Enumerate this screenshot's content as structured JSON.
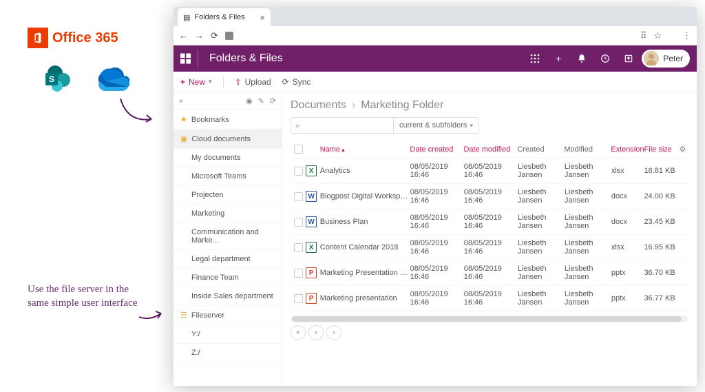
{
  "annotations": {
    "o365": "Office 365",
    "fileserver_note": "Use the file server in the same simple user interface"
  },
  "browser": {
    "tab_title": "Folders & Files"
  },
  "header": {
    "title": "Folders & Files",
    "user_name": "Peter"
  },
  "toolbar": {
    "new_label": "New",
    "upload_label": "Upload",
    "sync_label": "Sync"
  },
  "sidebar": {
    "bookmarks": "Bookmarks",
    "cloud": "Cloud documents",
    "folders": [
      "My documents",
      "Microsoft Teams",
      "Projecten",
      "Marketing",
      "Communication and Marke...",
      "Legal department",
      "Finance Team",
      "Inside Sales department"
    ],
    "fileserver": "Fileserver",
    "drives": [
      "Y:/",
      "Z:/"
    ]
  },
  "breadcrumb": {
    "seg1": "Documents",
    "seg2": "Marketing Folder"
  },
  "search": {
    "scope": "current & subfolders"
  },
  "columns": {
    "name": "Name",
    "date_created": "Date created",
    "date_modified": "Date modified",
    "created": "Created",
    "modified": "Modified",
    "extension": "Extension",
    "file_size": "File size"
  },
  "rows": [
    {
      "name": "Analytics",
      "dc": "08/05/2019 16:46",
      "dm": "08/05/2019 16:46",
      "cby": "Liesbeth Jansen",
      "mby": "Liesbeth Jansen",
      "ext": "xlsx",
      "size": "16.81 KB",
      "icon": "xlsx",
      "glyph": "X"
    },
    {
      "name": "Blogpost Digital Workspace",
      "dc": "08/05/2019 16:46",
      "dm": "08/05/2019 16:46",
      "cby": "Liesbeth Jansen",
      "mby": "Liesbeth Jansen",
      "ext": "docx",
      "size": "24.00 KB",
      "icon": "docx",
      "glyph": "W"
    },
    {
      "name": "Business Plan",
      "dc": "08/05/2019 16:46",
      "dm": "08/05/2019 16:46",
      "cby": "Liesbeth Jansen",
      "mby": "Liesbeth Jansen",
      "ext": "docx",
      "size": "23.45 KB",
      "icon": "docx",
      "glyph": "W"
    },
    {
      "name": "Content Calendar 2018",
      "dc": "08/05/2019 16:46",
      "dm": "08/05/2019 16:46",
      "cby": "Liesbeth Jansen",
      "mby": "Liesbeth Jansen",
      "ext": "xlsx",
      "size": "16.95 KB",
      "icon": "xlsx",
      "glyph": "X"
    },
    {
      "name": "Marketing Presentation Oct...",
      "dc": "08/05/2019 16:46",
      "dm": "08/05/2019 16:46",
      "cby": "Liesbeth Jansen",
      "mby": "Liesbeth Jansen",
      "ext": "pptx",
      "size": "36.70 KB",
      "icon": "pptx",
      "glyph": "P"
    },
    {
      "name": "Marketing presentation",
      "dc": "08/05/2019 16:46",
      "dm": "08/05/2019 16:46",
      "cby": "Liesbeth Jansen",
      "mby": "Liesbeth Jansen",
      "ext": "pptx",
      "size": "36.77 KB",
      "icon": "pptx",
      "glyph": "P"
    }
  ]
}
